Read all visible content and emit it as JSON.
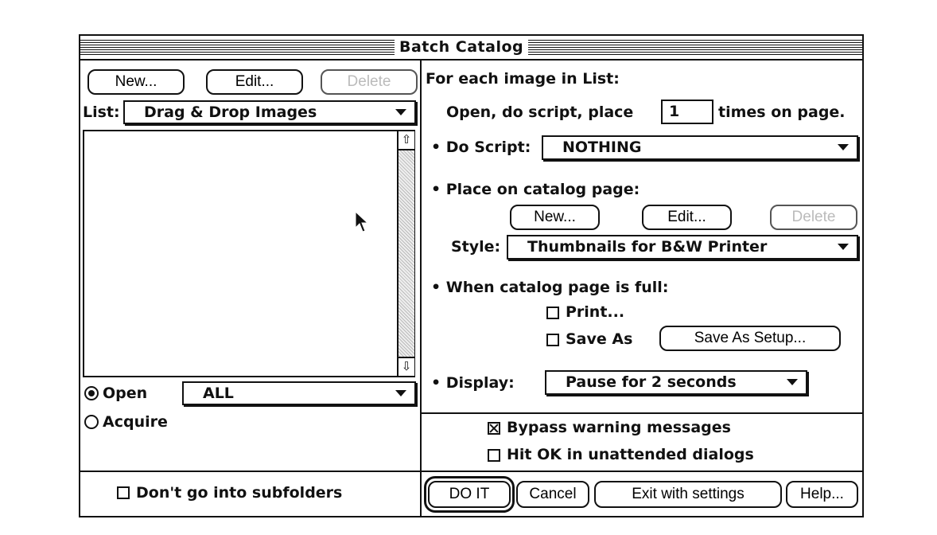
{
  "window": {
    "title": "Batch Catalog"
  },
  "list_panel": {
    "new_label": "New...",
    "edit_label": "Edit...",
    "delete_label": "Delete",
    "list_label": "List:",
    "list_value": "Drag & Drop Images",
    "open_label": "Open",
    "open_value": "ALL",
    "acquire_label": "Acquire",
    "subfolders_label": "Don't go into subfolders",
    "open_selected": true,
    "subfolders_checked": false
  },
  "options": {
    "heading": "For each image in List:",
    "open_prefix": "Open, do script, place",
    "times_value": "1",
    "open_suffix": "times on page.",
    "do_script_label": "• Do Script:",
    "do_script_value": "NOTHING",
    "place_label": "• Place on catalog page:",
    "new_label": "New...",
    "edit_label": "Edit...",
    "delete_label": "Delete",
    "style_label": "Style:",
    "style_value": "Thumbnails for B&W Printer",
    "full_label": "• When catalog page is full:",
    "print_label": "Print...",
    "save_as_label": "Save As",
    "save_setup_label": "Save As Setup...",
    "display_label": "• Display:",
    "display_value": "Pause for 2 seconds",
    "bypass_label": "Bypass warning messages",
    "bypass_checked": true,
    "hitok_label": "Hit OK in unattended dialogs",
    "hitok_checked": false
  },
  "actions": {
    "do_it": "DO IT",
    "cancel": "Cancel",
    "exit_settings": "Exit with settings",
    "help": "Help..."
  }
}
